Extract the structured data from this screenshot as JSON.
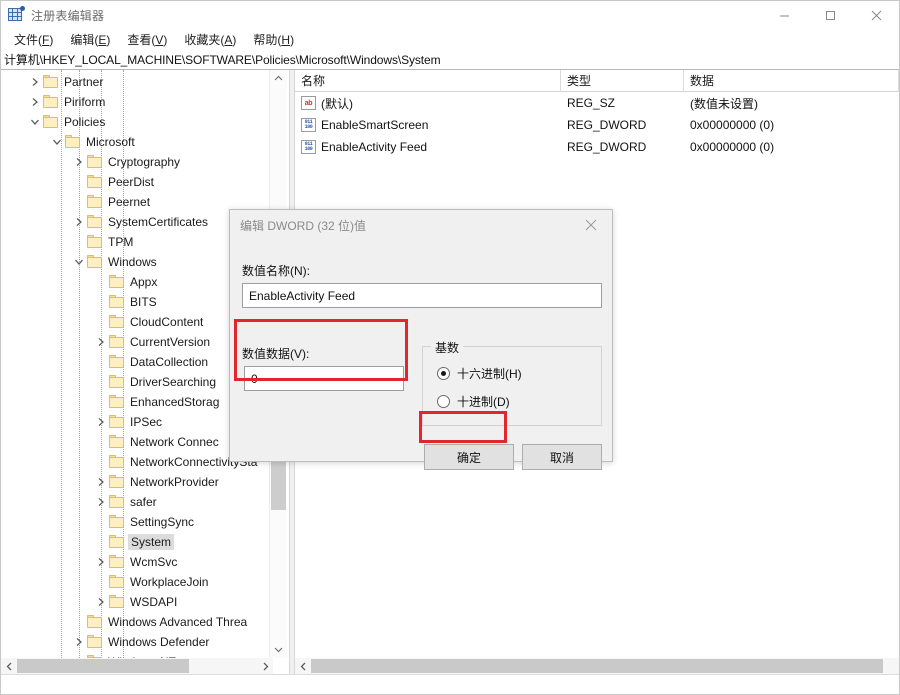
{
  "window": {
    "title": "注册表编辑器",
    "icon": "registry-editor-icon",
    "controls": {
      "minimize": "minimize-icon",
      "maximize": "maximize-icon",
      "close": "close-icon"
    }
  },
  "menubar": {
    "items": [
      {
        "label": "文件(F)",
        "text": "文件(",
        "accel": "F",
        "tail": ")"
      },
      {
        "label": "编辑(E)",
        "text": "编辑(",
        "accel": "E",
        "tail": ")"
      },
      {
        "label": "查看(V)",
        "text": "查看(",
        "accel": "V",
        "tail": ")"
      },
      {
        "label": "收藏夹(A)",
        "text": "收藏夹(",
        "accel": "A",
        "tail": ")"
      },
      {
        "label": "帮助(H)",
        "text": "帮助(",
        "accel": "H",
        "tail": ")"
      }
    ]
  },
  "address": {
    "path": "计算机\\HKEY_LOCAL_MACHINE\\SOFTWARE\\Policies\\Microsoft\\Windows\\System"
  },
  "tree": {
    "items": [
      {
        "label": "Partner",
        "depth": 1,
        "expander": "collapsed",
        "selected": false
      },
      {
        "label": "Piriform",
        "depth": 1,
        "expander": "collapsed",
        "selected": false
      },
      {
        "label": "Policies",
        "depth": 1,
        "expander": "expanded",
        "selected": false
      },
      {
        "label": "Microsoft",
        "depth": 2,
        "expander": "expanded",
        "selected": false
      },
      {
        "label": "Cryptography",
        "depth": 3,
        "expander": "collapsed",
        "selected": false
      },
      {
        "label": "PeerDist",
        "depth": 3,
        "expander": "none",
        "selected": false
      },
      {
        "label": "Peernet",
        "depth": 3,
        "expander": "none",
        "selected": false
      },
      {
        "label": "SystemCertificates",
        "depth": 3,
        "expander": "collapsed",
        "selected": false
      },
      {
        "label": "TPM",
        "depth": 3,
        "expander": "none",
        "selected": false
      },
      {
        "label": "Windows",
        "depth": 3,
        "expander": "expanded",
        "selected": false
      },
      {
        "label": "Appx",
        "depth": 4,
        "expander": "none",
        "selected": false
      },
      {
        "label": "BITS",
        "depth": 4,
        "expander": "none",
        "selected": false
      },
      {
        "label": "CloudContent",
        "depth": 4,
        "expander": "none",
        "selected": false
      },
      {
        "label": "CurrentVersion",
        "depth": 4,
        "expander": "collapsed",
        "selected": false
      },
      {
        "label": "DataCollection",
        "depth": 4,
        "expander": "none",
        "selected": false
      },
      {
        "label": "DriverSearching",
        "depth": 4,
        "expander": "none",
        "selected": false
      },
      {
        "label": "EnhancedStorag",
        "depth": 4,
        "expander": "none",
        "selected": false
      },
      {
        "label": "IPSec",
        "depth": 4,
        "expander": "collapsed",
        "selected": false
      },
      {
        "label": "Network Connec",
        "depth": 4,
        "expander": "none",
        "selected": false
      },
      {
        "label": "NetworkConnectivitySta",
        "depth": 4,
        "expander": "none",
        "selected": false
      },
      {
        "label": "NetworkProvider",
        "depth": 4,
        "expander": "collapsed",
        "selected": false
      },
      {
        "label": "safer",
        "depth": 4,
        "expander": "collapsed",
        "selected": false
      },
      {
        "label": "SettingSync",
        "depth": 4,
        "expander": "none",
        "selected": false
      },
      {
        "label": "System",
        "depth": 4,
        "expander": "none",
        "selected": true
      },
      {
        "label": "WcmSvc",
        "depth": 4,
        "expander": "collapsed",
        "selected": false
      },
      {
        "label": "WorkplaceJoin",
        "depth": 4,
        "expander": "none",
        "selected": false
      },
      {
        "label": "WSDAPI",
        "depth": 4,
        "expander": "collapsed",
        "selected": false
      },
      {
        "label": "Windows Advanced Threa",
        "depth": 3,
        "expander": "none",
        "selected": false
      },
      {
        "label": "Windows Defender",
        "depth": 3,
        "expander": "collapsed",
        "selected": false
      },
      {
        "label": "Windows NT",
        "depth": 3,
        "expander": "collapsed",
        "selected": false
      }
    ]
  },
  "values": {
    "columns": [
      "名称",
      "类型",
      "数据"
    ],
    "rows": [
      {
        "icon": "string-value-icon",
        "icon_glyph": "ab",
        "name": "(默认)",
        "type": "REG_SZ",
        "data": "(数值未设置)"
      },
      {
        "icon": "dword-value-icon",
        "icon_glyph": "",
        "name": "EnableSmartScreen",
        "type": "REG_DWORD",
        "data": "0x00000000 (0)"
      },
      {
        "icon": "dword-value-icon",
        "icon_glyph": "",
        "name": "EnableActivity Feed",
        "type": "REG_DWORD",
        "data": "0x00000000 (0)"
      }
    ]
  },
  "dialog": {
    "title": "编辑 DWORD (32 位)值",
    "close_icon": "close-icon",
    "name_label": "数值名称(N):",
    "name_value": "EnableActivity Feed",
    "data_label": "数值数据(V):",
    "data_value": "0",
    "base_group_label": "基数",
    "radios": [
      {
        "label": "十六进制(H)",
        "checked": true
      },
      {
        "label": "十进制(D)",
        "checked": false
      }
    ],
    "ok_label": "确定",
    "cancel_label": "取消"
  },
  "annotations": {
    "highlight_color": "#e1272c",
    "boxes": [
      "value-data-field-highlight",
      "ok-button-highlight"
    ]
  }
}
